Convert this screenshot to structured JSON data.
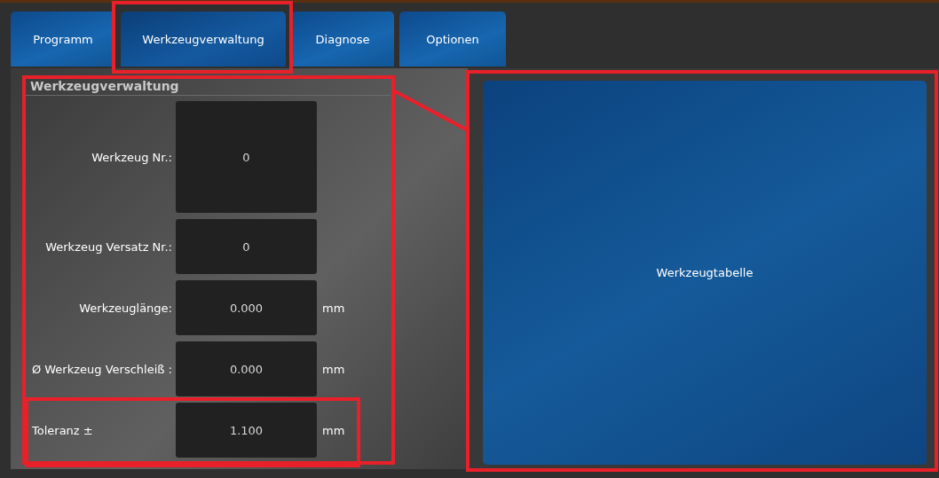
{
  "tabs": [
    {
      "label": "Programm",
      "selected": false
    },
    {
      "label": "Werkzeugverwaltung",
      "selected": true
    },
    {
      "label": "Diagnose",
      "selected": false
    },
    {
      "label": "Optionen",
      "selected": false
    }
  ],
  "group": {
    "title": "Werkzeugverwaltung",
    "fields": [
      {
        "label": "Werkzeug Nr.:",
        "value": "0",
        "kind": "id"
      },
      {
        "label": "Werkzeug Versatz Nr.:",
        "value": "0",
        "kind": "number"
      },
      {
        "label": "Werkzeuglänge:",
        "value": "0.000",
        "unit": "mm",
        "kind": "measure"
      },
      {
        "label": "Ø Werkzeug Verschleiß :",
        "value": "0.000",
        "unit": "mm",
        "kind": "measure"
      },
      {
        "label": "Toleranz ±",
        "value": "1.100",
        "unit": "mm",
        "kind": "tolerance"
      }
    ]
  },
  "table_button": {
    "label": "Werkzeugtabelle"
  }
}
